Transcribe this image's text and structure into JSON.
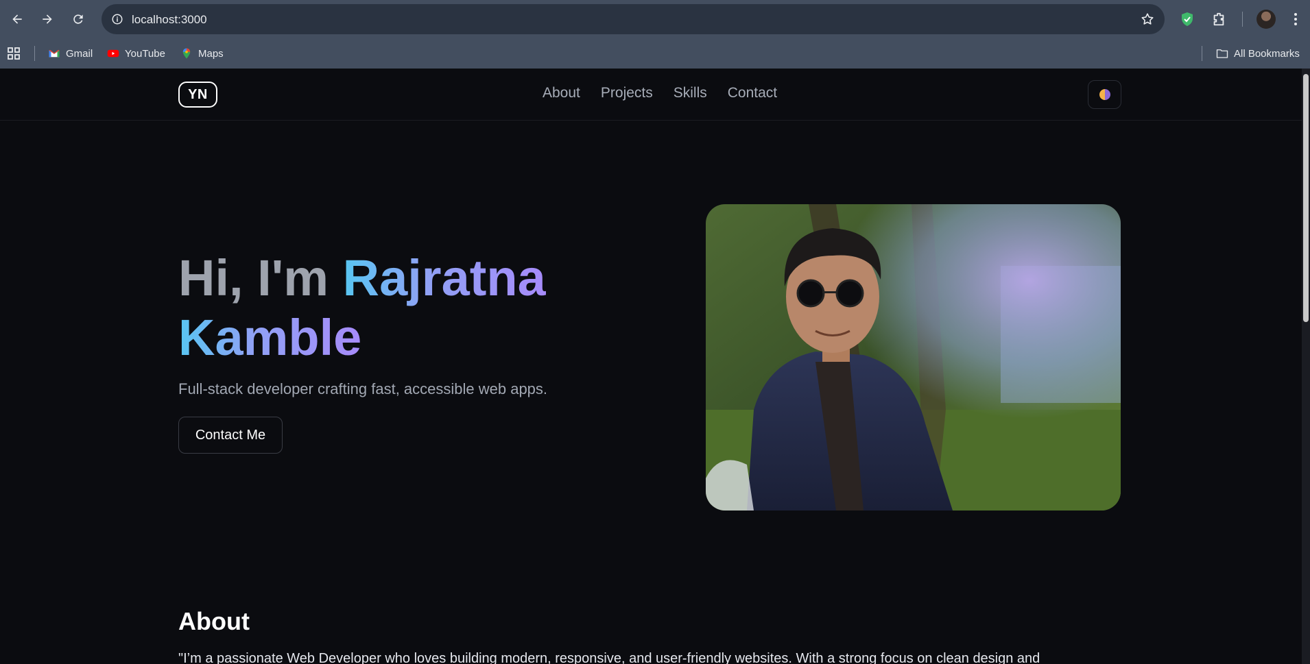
{
  "browser": {
    "url": "localhost:3000",
    "bookmarks": [
      {
        "label": "Gmail",
        "icon": "gmail-icon"
      },
      {
        "label": "YouTube",
        "icon": "youtube-icon"
      },
      {
        "label": "Maps",
        "icon": "maps-icon"
      }
    ],
    "all_bookmarks": "All Bookmarks"
  },
  "site": {
    "logo": "YN",
    "nav": [
      "About",
      "Projects",
      "Skills",
      "Contact"
    ],
    "hero": {
      "greeting": "Hi, I'm ",
      "name_first": "Rajratna",
      "name_last": "Kamble",
      "subtitle": "Full-stack developer crafting fast, accessible web apps.",
      "cta": "Contact Me"
    },
    "about": {
      "title": "About",
      "text": "\"I’m a passionate Web Developer who loves building modern, responsive, and user-friendly websites. With a strong focus on clean design and"
    }
  },
  "colors": {
    "chrome": "#434e5f",
    "page_bg": "#0b0c10",
    "gradient_start": "#58c6f2",
    "gradient_end": "#a78bfa"
  }
}
